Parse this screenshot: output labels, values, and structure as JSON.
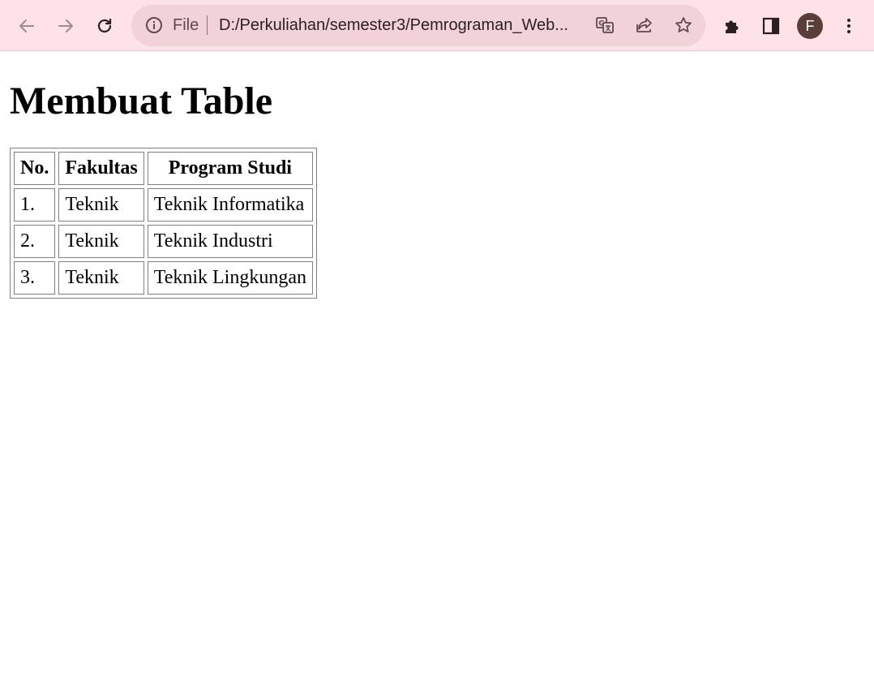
{
  "browser": {
    "address": {
      "scheme_label": "File",
      "url": "D:/Perkuliahan/semester3/Pemrograman_Web..."
    },
    "profile_initial": "F",
    "toolbar_color": "#fde3e8",
    "omnibox_color": "#f1d2d8",
    "icons": [
      "back-arrow-icon",
      "forward-arrow-icon",
      "reload-icon",
      "info-icon",
      "translate-icon",
      "share-icon",
      "star-icon",
      "puzzle-icon",
      "side-panel-icon",
      "kebab-menu-icon"
    ]
  },
  "page": {
    "heading": "Membuat Table",
    "table": {
      "headers": [
        "No.",
        "Fakultas",
        "Program Studi"
      ],
      "rows": [
        [
          "1.",
          "Teknik",
          "Teknik Informatika"
        ],
        [
          "2.",
          "Teknik",
          "Teknik Industri"
        ],
        [
          "3.",
          "Teknik",
          "Teknik Lingkungan"
        ]
      ]
    }
  }
}
